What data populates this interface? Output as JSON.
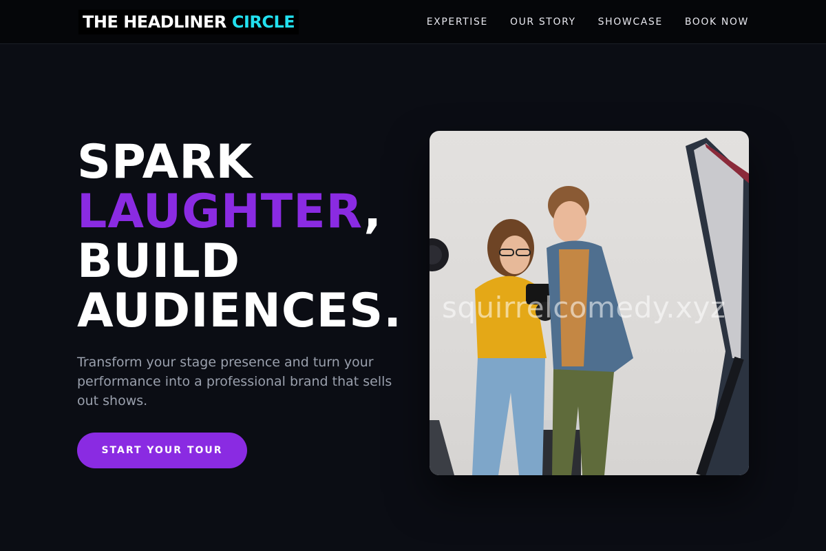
{
  "brand": {
    "name_part1": "THE HEADLINER",
    "name_part2": "CIRCLE",
    "accent_color": "#22e0ee"
  },
  "nav": {
    "items": [
      {
        "label": "EXPERTISE"
      },
      {
        "label": "OUR STORY"
      },
      {
        "label": "SHOWCASE"
      },
      {
        "label": "BOOK NOW"
      }
    ]
  },
  "hero": {
    "line1": "SPARK",
    "line2_highlight": "LAUGHTER",
    "line2_suffix": ",",
    "line3": "BUILD",
    "line4": "AUDIENCES.",
    "highlight_color": "#8a2be2",
    "subtitle": "Transform your stage presence and turn your performance into a professional brand that sells out shows.",
    "cta_label": "START YOUR TOUR"
  },
  "image": {
    "description": "photographer-and-comedian-reviewing-camera",
    "watermark": "squirrelcomedy.xyz"
  }
}
